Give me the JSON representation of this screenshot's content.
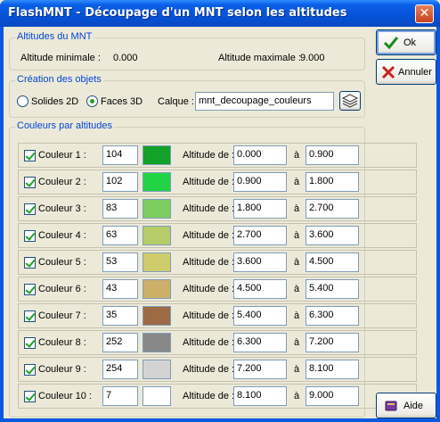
{
  "window": {
    "title": "FlashMNT - Découpage d'un MNT selon les altitudes",
    "close_glyph": "✕"
  },
  "altitudes": {
    "group_label": "Altitudes du MNT",
    "min_label": "Altitude minimale :",
    "min_value": "0.000",
    "max_label": "Altitude maximale :",
    "max_value": "9.000"
  },
  "creation": {
    "group_label": "Création des objets",
    "solides_label": "Solides 2D",
    "faces_label": "Faces 3D",
    "selected": "Faces 3D",
    "calque_label": "Calque :",
    "calque_value": "mnt_decoupage_couleurs"
  },
  "couleurs": {
    "group_label": "Couleurs par altitudes",
    "alt_label": "Altitude de :",
    "a_label": "à",
    "rows": [
      {
        "label": "Couleur 1 :",
        "code": "104",
        "color": "#12a12a",
        "min": "0.000",
        "max": "0.900",
        "checked": true
      },
      {
        "label": "Couleur 2 :",
        "code": "102",
        "color": "#22d444",
        "min": "0.900",
        "max": "1.800",
        "checked": true
      },
      {
        "label": "Couleur 3 :",
        "code": "83",
        "color": "#7ccd62",
        "min": "1.800",
        "max": "2.700",
        "checked": true
      },
      {
        "label": "Couleur 4 :",
        "code": "63",
        "color": "#b5cc69",
        "min": "2.700",
        "max": "3.600",
        "checked": true
      },
      {
        "label": "Couleur 5 :",
        "code": "53",
        "color": "#cfcc6c",
        "min": "3.600",
        "max": "4.500",
        "checked": true
      },
      {
        "label": "Couleur 6 :",
        "code": "43",
        "color": "#ccb06a",
        "min": "4.500",
        "max": "5.400",
        "checked": true
      },
      {
        "label": "Couleur 7 :",
        "code": "35",
        "color": "#9c6a45",
        "min": "5.400",
        "max": "6.300",
        "checked": true
      },
      {
        "label": "Couleur 8 :",
        "code": "252",
        "color": "#878787",
        "min": "6.300",
        "max": "7.200",
        "checked": true
      },
      {
        "label": "Couleur 9 :",
        "code": "254",
        "color": "#d3d3d3",
        "min": "7.200",
        "max": "8.100",
        "checked": true
      },
      {
        "label": "Couleur 10 :",
        "code": "7",
        "color": "#ffffff",
        "min": "8.100",
        "max": "9.000",
        "checked": true
      }
    ]
  },
  "buttons": {
    "ok_label": "Ok",
    "cancel_label": "Annuler",
    "help_label": "Aide"
  }
}
